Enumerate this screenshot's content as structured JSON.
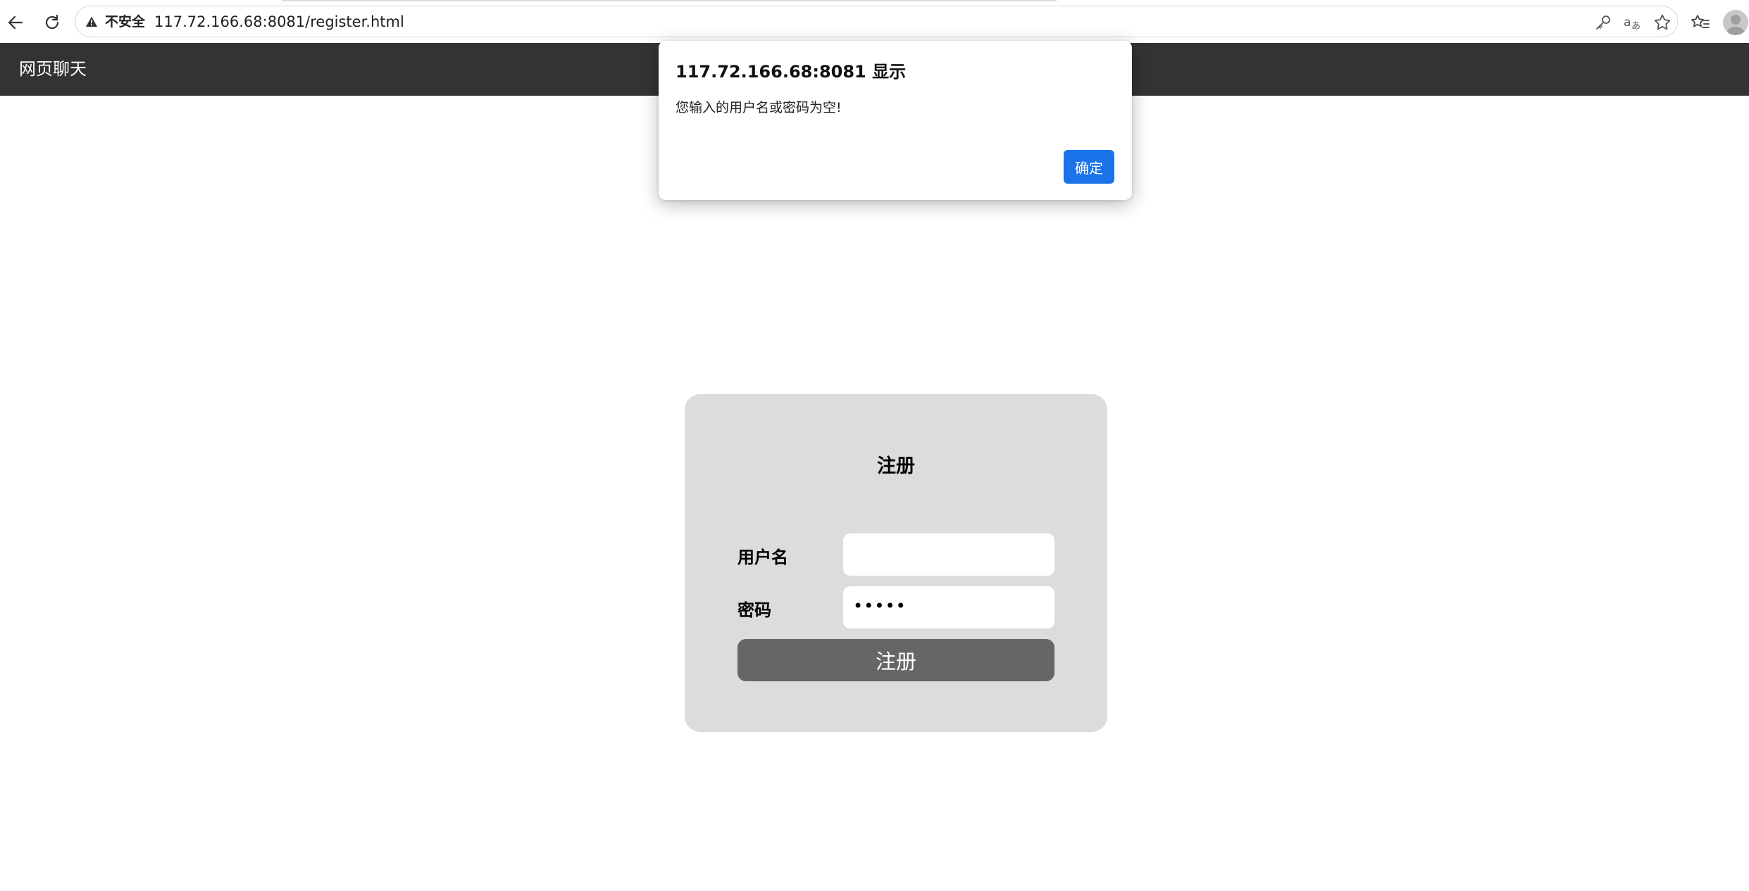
{
  "browser": {
    "security_label": "不安全",
    "url": "117.72.166.68:8081/register.html",
    "icons": {
      "back": "back-arrow-icon",
      "reload": "reload-icon",
      "warning": "warning-icon",
      "key": "key-icon",
      "translate": "translate-icon",
      "star": "star-icon",
      "favorites": "favorites-icon",
      "profile": "profile-avatar"
    }
  },
  "app": {
    "title": "网页聊天"
  },
  "alert": {
    "title": "117.72.166.68:8081 显示",
    "message": "您输入的用户名或密码为空!",
    "ok_label": "确定"
  },
  "register": {
    "title": "注册",
    "username_label": "用户名",
    "username_value": "",
    "password_label": "密码",
    "password_masked": "•••••",
    "submit_label": "注册"
  },
  "colors": {
    "appbar": "#333333",
    "card": "#dcdcdc",
    "submit": "#666666",
    "dialog_button": "#1a73e8"
  }
}
